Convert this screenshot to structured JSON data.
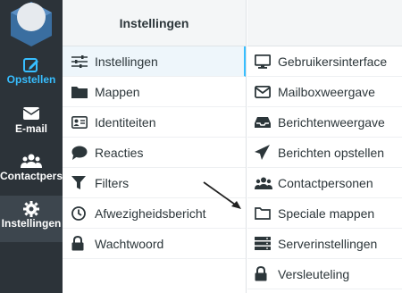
{
  "nav": {
    "items": [
      {
        "label": "Opstellen",
        "icon": "compose-icon"
      },
      {
        "label": "E-mail",
        "icon": "envelope-icon"
      },
      {
        "label": "Contactpersonen",
        "icon": "contacts-icon"
      },
      {
        "label": "Instellingen",
        "icon": "gear-icon"
      }
    ]
  },
  "settings": {
    "header": "Instellingen",
    "sections": [
      {
        "label": "Instellingen",
        "icon": "sliders-icon"
      },
      {
        "label": "Mappen",
        "icon": "folder-icon"
      },
      {
        "label": "Identiteiten",
        "icon": "id-card-icon"
      },
      {
        "label": "Reacties",
        "icon": "comment-icon"
      },
      {
        "label": "Filters",
        "icon": "filter-icon"
      },
      {
        "label": "Afwezigheidsbericht",
        "icon": "clock-icon"
      },
      {
        "label": "Wachtwoord",
        "icon": "lock-icon"
      }
    ]
  },
  "preferences": {
    "items": [
      {
        "label": "Gebruikersinterface",
        "icon": "monitor-icon"
      },
      {
        "label": "Mailboxweergave",
        "icon": "envelope-outline-icon"
      },
      {
        "label": "Berichtenweergave",
        "icon": "inbox-icon"
      },
      {
        "label": "Berichten opstellen",
        "icon": "paper-plane-icon"
      },
      {
        "label": "Contactpersonen",
        "icon": "users-icon"
      },
      {
        "label": "Speciale mappen",
        "icon": "folder-outline-icon"
      },
      {
        "label": "Serverinstellingen",
        "icon": "server-icon"
      },
      {
        "label": "Versleuteling",
        "icon": "lock-icon"
      }
    ]
  },
  "colors": {
    "accent": "#37beff",
    "sidebar": "#2c3339",
    "text": "#2c363a"
  }
}
